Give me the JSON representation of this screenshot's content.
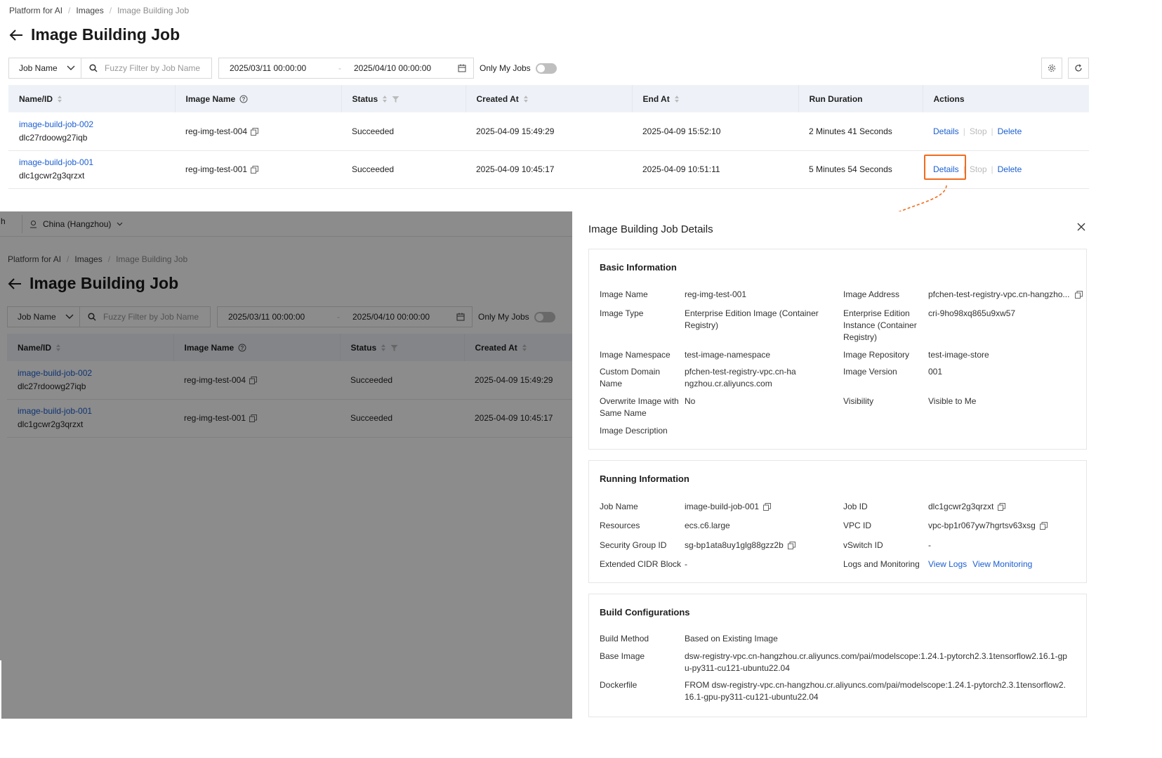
{
  "breadcrumb": [
    "Platform for AI",
    "Images",
    "Image Building Job"
  ],
  "page_title": "Image Building Job",
  "toolbar": {
    "field_select": "Job Name",
    "search_placeholder": "Fuzzy Filter by Job Name",
    "date_start": "2025/03/11 00:00:00",
    "date_end": "2025/04/10 00:00:00",
    "date_separator": "-",
    "only_my_jobs": "Only My Jobs"
  },
  "table": {
    "columns": [
      "Name/ID",
      "Image Name",
      "Status",
      "Created At",
      "End At",
      "Run Duration",
      "Actions"
    ],
    "rows": [
      {
        "name": "image-build-job-002",
        "id": "dlc27rdoowg27iqb",
        "image": "reg-img-test-004",
        "status": "Succeeded",
        "created": "2025-04-09 15:49:29",
        "end": "2025-04-09 15:52:10",
        "duration": "2 Minutes 41 Seconds"
      },
      {
        "name": "image-build-job-001",
        "id": "dlc1gcwr2g3qrzxt",
        "image": "reg-img-test-001",
        "status": "Succeeded",
        "created": "2025-04-09 10:45:17",
        "end": "2025-04-09 10:51:11",
        "duration": "5 Minutes 54 Seconds"
      }
    ],
    "actions": {
      "details": "Details",
      "stop": "Stop",
      "delete": "Delete"
    }
  },
  "lower": {
    "tab_partial": "h",
    "region": "China (Hangzhou)"
  },
  "drawer": {
    "title": "Image Building Job Details",
    "basic": {
      "title": "Basic Information",
      "image_name_label": "Image Name",
      "image_name": "reg-img-test-001",
      "image_address_label": "Image Address",
      "image_address": "pfchen-test-registry-vpc.cn-hangzho...",
      "image_type_label": "Image Type",
      "image_type": "Enterprise Edition Image (Container Registry)",
      "instance_label": "Enterprise Edition Instance (Container Registry)",
      "instance": "cri-9ho98xq865u9xw57",
      "namespace_label": "Image Namespace",
      "namespace": "test-image-namespace",
      "repository_label": "Image Repository",
      "repository": "test-image-store",
      "domain_label": "Custom Domain Name",
      "domain": "pfchen-test-registry-vpc.cn-hangzhou.cr.aliyuncs.com",
      "version_label": "Image Version",
      "version": "001",
      "overwrite_label": "Overwrite Image with Same Name",
      "overwrite": "No",
      "visibility_label": "Visibility",
      "visibility": "Visible to Me",
      "description_label": "Image Description"
    },
    "running": {
      "title": "Running Information",
      "job_name_label": "Job Name",
      "job_name": "image-build-job-001",
      "job_id_label": "Job ID",
      "job_id": "dlc1gcwr2g3qrzxt",
      "resources_label": "Resources",
      "resources": "ecs.c6.large",
      "vpc_label": "VPC ID",
      "vpc": "vpc-bp1r067yw7hgrtsv63xsg",
      "sg_label": "Security Group ID",
      "sg": "sg-bp1ata8uy1glg88gzz2b",
      "vswitch_label": "vSwitch ID",
      "vswitch": "-",
      "cidr_label": "Extended CIDR Block",
      "cidr": "-",
      "logs_label": "Logs and Monitoring",
      "view_logs": "View Logs",
      "view_monitoring": "View Monitoring"
    },
    "build": {
      "title": "Build Configurations",
      "method_label": "Build Method",
      "method": "Based on Existing Image",
      "base_label": "Base Image",
      "base": "dsw-registry-vpc.cn-hangzhou.cr.aliyuncs.com/pai/modelscope:1.24.1-pytorch2.3.1tensorflow2.16.1-gpu-py311-cu121-ubuntu22.04",
      "dockerfile_label": "Dockerfile",
      "dockerfile": "FROM dsw-registry-vpc.cn-hangzhou.cr.aliyuncs.com/pai/modelscope:1.24.1-pytorch2.3.1tensorflow2.16.1-gpu-py311-cu121-ubuntu22.04"
    }
  },
  "colors": {
    "link": "#1b5fd1",
    "highlight": "#f26b1d",
    "header_bg": "#eef2f8"
  }
}
